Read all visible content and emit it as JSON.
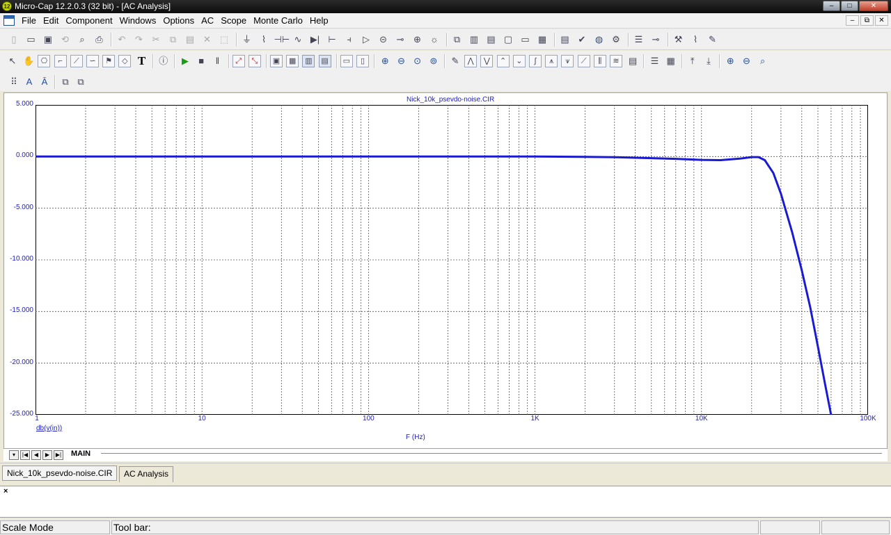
{
  "app": {
    "title": "Micro-Cap 12.2.0.3 (32 bit) - [AC Analysis]",
    "icon_text": "12"
  },
  "window_controls": {
    "minimize": "–",
    "restore": "□",
    "close": "✕",
    "mdi_minimize": "–",
    "mdi_restore": "⧉",
    "mdi_close": "✕"
  },
  "menu": [
    "File",
    "Edit",
    "Component",
    "Windows",
    "Options",
    "AC",
    "Scope",
    "Monte Carlo",
    "Help"
  ],
  "toolbar_icons": {
    "row1": [
      "new-file-icon",
      "open-file-icon",
      "save-icon",
      "revert-icon",
      "print-preview-icon",
      "print-icon",
      "undo-icon",
      "redo-icon",
      "cut-icon",
      "copy-icon",
      "paste-icon",
      "delete-icon",
      "select-all-icon",
      "ground-icon",
      "resistor-icon",
      "capacitor-icon",
      "inductor-icon",
      "diode-icon",
      "transistor-icon",
      "battery-icon",
      "opamp-icon",
      "source-icon",
      "switch-icon",
      "node-icon",
      "bulb-icon",
      "window-cascade-icon",
      "tile-vertical-icon",
      "tile-horizontal-icon",
      "window-icon",
      "single-window-icon",
      "calculator-icon",
      "component-library-icon",
      "check-icon",
      "globe-icon",
      "parts-icon",
      "list-icon",
      "probe-icon",
      "tools-icon",
      "chart-icon",
      "edit-chart-icon"
    ],
    "row2": [
      "select-arrow-icon",
      "pan-hand-icon",
      "component-mode-icon",
      "wire-icon",
      "diagonal-wire-icon",
      "bezier-icon",
      "flag-icon",
      "graphics-icon",
      "text-icon",
      "info-icon",
      "run-icon",
      "stop-icon",
      "pause-icon",
      "scale-icon",
      "auto-scale-icon",
      "plot-properties-icon",
      "grid-icon",
      "tokens-icon",
      "data-points-icon",
      "horizontal-line-icon",
      "vertical-line-icon",
      "zoom-in-icon",
      "zoom-out-icon",
      "zoom-fit-icon",
      "zoom-select-icon",
      "animate-icon",
      "peak-icon",
      "valley-icon",
      "high-icon",
      "low-icon",
      "inflection-icon",
      "global-high-icon",
      "global-low-icon",
      "slope-icon",
      "x-value-icon",
      "y-value-icon",
      "clipboard-icon",
      "properties-icon",
      "calendar-icon",
      "export-icon",
      "import-icon",
      "zoom-in-small-icon",
      "zoom-out-small-icon",
      "magnify-icon"
    ],
    "row3": [
      "grid-dots-icon",
      "font-icon",
      "font-color-icon",
      "copy-format-icon",
      "paste-format-icon"
    ]
  },
  "plot": {
    "title": "Nick_10k_psevdo-noise.CIR",
    "trace_label": "db(v(in))",
    "x_axis_title": "F (Hz)",
    "page_tab": "MAIN",
    "trace_color": "#1a1ad0",
    "label_color": "#2020c0"
  },
  "chart_data": {
    "type": "line",
    "xscale": "log",
    "xlim": [
      1,
      100000
    ],
    "ylim": [
      -25,
      5
    ],
    "grid": true,
    "x_tick_labels": [
      "1",
      "10",
      "100",
      "1K",
      "10K",
      "100K"
    ],
    "y_tick_labels": [
      "5.000",
      "0.000",
      "-5.000",
      "-10.000",
      "-15.000",
      "-20.000",
      "-25.000"
    ],
    "series": [
      {
        "name": "db(v(in))",
        "x": [
          1,
          10,
          100,
          1000,
          2000,
          3000,
          5000,
          7000,
          10000,
          13000,
          17000,
          20000,
          22000,
          24000,
          27000,
          30000,
          35000,
          40000,
          45000,
          50000,
          55000,
          60000
        ],
        "y": [
          0,
          0,
          0,
          0,
          -0.03,
          -0.06,
          -0.15,
          -0.22,
          -0.32,
          -0.35,
          -0.2,
          -0.05,
          -0.05,
          -0.35,
          -1.6,
          -3.6,
          -7.3,
          -11.0,
          -14.6,
          -18.4,
          -21.9,
          -25.0
        ]
      }
    ]
  },
  "doc_tabs": [
    "Nick_10k_psevdo-noise.CIR",
    "AC Analysis"
  ],
  "status": {
    "mode": "Scale Mode",
    "toolbar": "Tool bar:"
  },
  "output": {
    "close": "×"
  }
}
